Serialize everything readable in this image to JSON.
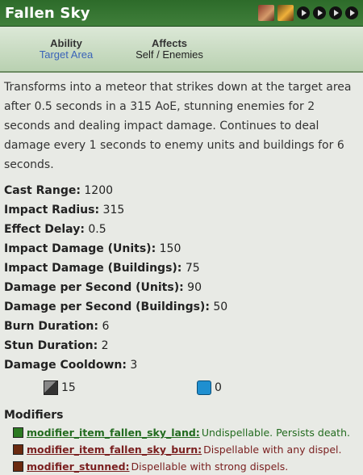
{
  "header": {
    "title": "Fallen Sky",
    "icons": [
      "hero-portrait-1",
      "hero-portrait-2",
      "play-icon",
      "play-icon",
      "play-icon",
      "play-icon"
    ]
  },
  "subheader": {
    "ability_label": "Ability",
    "ability_value": "Target Area",
    "affects_label": "Affects",
    "affects_value": "Self / Enemies"
  },
  "description": "Transforms into a meteor that strikes down at the target area after 0.5 seconds in a 315 AoE, stunning enemies for 2 seconds and dealing impact damage. Continues to deal damage every 1 seconds to enemy units and buildings for 6 seconds.",
  "stats": [
    {
      "k": "Cast Range:",
      "v": "1200"
    },
    {
      "k": "Impact Radius:",
      "v": "315"
    },
    {
      "k": "Effect Delay:",
      "v": "0.5"
    },
    {
      "k": "Impact Damage (Units):",
      "v": "150"
    },
    {
      "k": "Impact Damage (Buildings):",
      "v": "75"
    },
    {
      "k": "Damage per Second (Units):",
      "v": "90"
    },
    {
      "k": "Damage per Second (Buildings):",
      "v": "50"
    },
    {
      "k": "Burn Duration:",
      "v": "6"
    },
    {
      "k": "Stun Duration:",
      "v": "2"
    },
    {
      "k": "Damage Cooldown:",
      "v": "3"
    }
  ],
  "costs": {
    "cooldown": "15",
    "mana": "0"
  },
  "modifiers_title": "Modifiers",
  "modifiers": [
    {
      "name": "modifier_item_fallen_sky_land:",
      "desc": "Undispellable. Persists death.",
      "color": "#2c7a22",
      "kind": "green"
    },
    {
      "name": "modifier_item_fallen_sky_burn:",
      "desc": "Dispellable with any dispel.",
      "color": "#6a2a10",
      "kind": "red"
    },
    {
      "name": "modifier_stunned:",
      "desc": "Dispellable with strong dispels.",
      "color": "#6a2a10",
      "kind": "red"
    }
  ]
}
